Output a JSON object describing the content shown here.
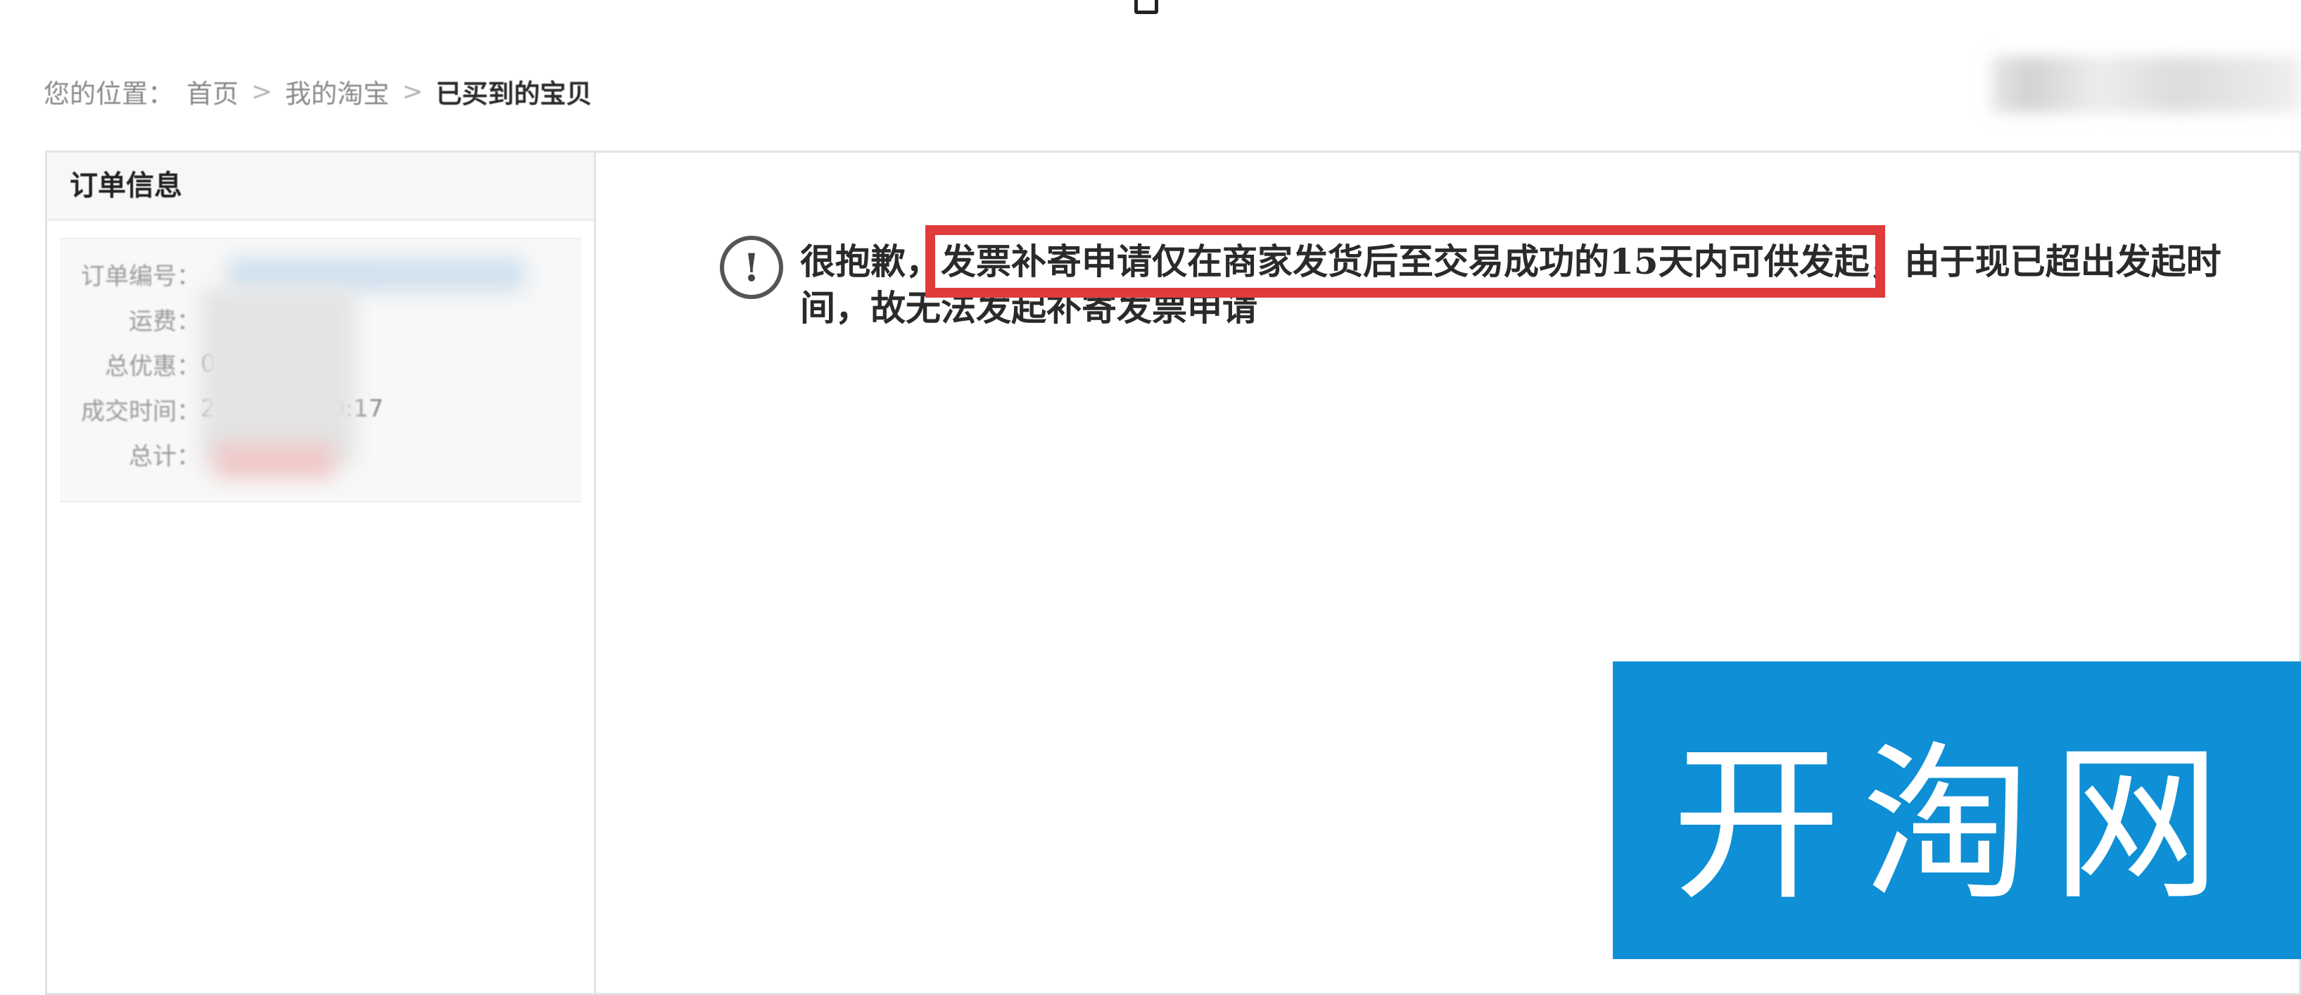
{
  "breadcrumb": {
    "prefix": "您的位置：",
    "items": [
      "首页",
      "我的淘宝",
      "已买到的宝贝"
    ],
    "separator": ">"
  },
  "sidebar": {
    "title": "订单信息",
    "rows": [
      {
        "key": "订单编号：",
        "value": ""
      },
      {
        "key": "运费：",
        "value": ""
      },
      {
        "key": "总优惠：",
        "value": "0."
      },
      {
        "key": "成交时间：",
        "value": "2          5 10:17"
      },
      {
        "key": "总计：",
        "value": ""
      }
    ]
  },
  "notice": {
    "lead": "很抱歉，",
    "highlight": "发票补寄申请仅在商家发货后至交易成功的15天内可供发起",
    "tail": "，由于现已超出发起时间，故无法发起补寄发票申请",
    "icon": "exclamation-circle-icon"
  },
  "watermark": {
    "text": "开淘网",
    "background": "#0e8fd6"
  },
  "colors": {
    "highlight_border": "#e03a3a",
    "text": "#2a2a2a"
  }
}
